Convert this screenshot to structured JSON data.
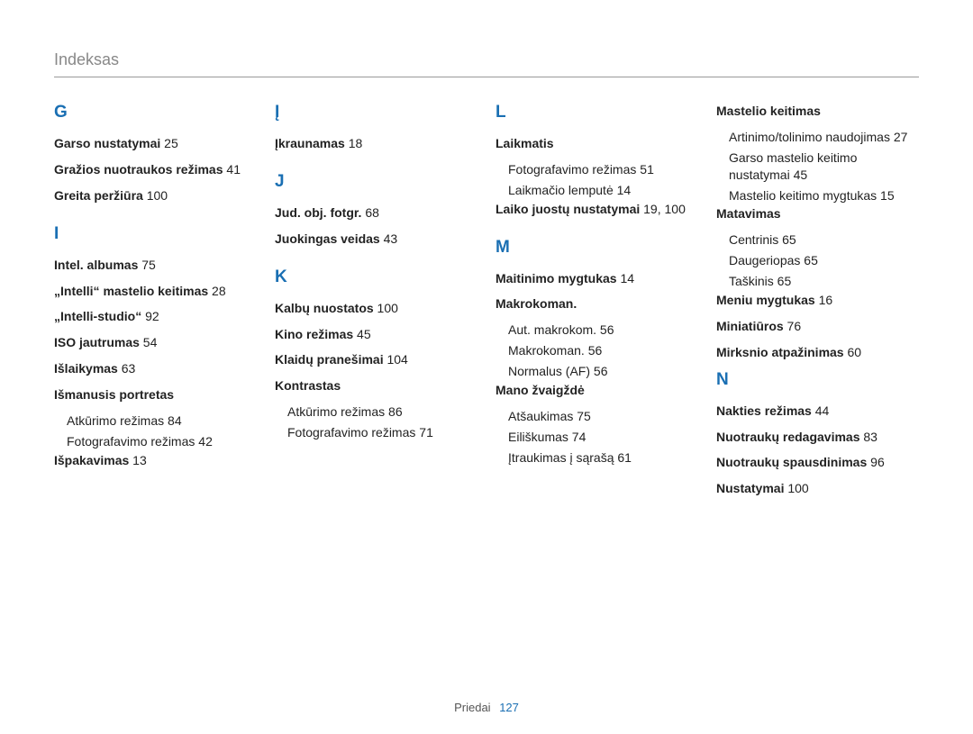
{
  "header": {
    "title": "Indeksas"
  },
  "footer": {
    "section": "Priedai",
    "page": "127"
  },
  "columns": [
    [
      {
        "type": "letter",
        "text": "G"
      },
      {
        "type": "entry",
        "main": "Garso nustatymai",
        "pg": "25"
      },
      {
        "type": "entry",
        "main": "Gražios nuotraukos režimas",
        "pg": "41"
      },
      {
        "type": "entry",
        "main": "Greita peržiūra",
        "pg": "100"
      },
      {
        "type": "letter",
        "text": "I"
      },
      {
        "type": "entry",
        "main": "Intel. albumas",
        "pg": "75"
      },
      {
        "type": "entry",
        "main": "„Intelli“ mastelio keitimas",
        "pg": "28"
      },
      {
        "type": "entry",
        "main": "„Intelli-studio“",
        "pg": "92"
      },
      {
        "type": "entry",
        "main": "ISO jautrumas",
        "pg": "54"
      },
      {
        "type": "entry",
        "main": "Išlaikymas",
        "pg": "63"
      },
      {
        "type": "entry",
        "main": "Išmanusis portretas",
        "subs": [
          {
            "text": "Atkūrimo režimas",
            "pg": "84"
          },
          {
            "text": "Fotografavimo režimas",
            "pg": "42"
          }
        ]
      },
      {
        "type": "entry",
        "main": "Išpakavimas",
        "pg": "13"
      }
    ],
    [
      {
        "type": "letter",
        "text": "Į"
      },
      {
        "type": "entry",
        "main": "Įkraunamas",
        "pg": "18"
      },
      {
        "type": "letter",
        "text": "J"
      },
      {
        "type": "entry",
        "main": "Jud. obj. fotgr.",
        "pg": "68"
      },
      {
        "type": "entry",
        "main": "Juokingas veidas",
        "pg": "43"
      },
      {
        "type": "letter",
        "text": "K"
      },
      {
        "type": "entry",
        "main": "Kalbų nuostatos",
        "pg": "100"
      },
      {
        "type": "entry",
        "main": "Kino režimas",
        "pg": "45"
      },
      {
        "type": "entry",
        "main": "Klaidų pranešimai",
        "pg": "104"
      },
      {
        "type": "entry",
        "main": "Kontrastas",
        "subs": [
          {
            "text": "Atkūrimo režimas",
            "pg": "86"
          },
          {
            "text": "Fotografavimo režimas",
            "pg": "71"
          }
        ]
      }
    ],
    [
      {
        "type": "letter",
        "text": "L"
      },
      {
        "type": "entry",
        "main": "Laikmatis",
        "subs": [
          {
            "text": "Fotografavimo režimas",
            "pg": "51"
          },
          {
            "text": "Laikmačio lemputė",
            "pg": "14"
          }
        ]
      },
      {
        "type": "entry",
        "main": "Laiko juostų nustatymai",
        "pg": "19, 100"
      },
      {
        "type": "letter",
        "text": "M"
      },
      {
        "type": "entry",
        "main": "Maitinimo mygtukas",
        "pg": "14"
      },
      {
        "type": "entry",
        "main": "Makrokoman.",
        "subs": [
          {
            "text": "Aut. makrokom.",
            "pg": "56"
          },
          {
            "text": "Makrokoman.",
            "pg": "56"
          },
          {
            "text": "Normalus (AF)",
            "pg": "56"
          }
        ]
      },
      {
        "type": "entry",
        "main": "Mano žvaigždė",
        "subs": [
          {
            "text": "Atšaukimas",
            "pg": "75"
          },
          {
            "text": "Eiliškumas",
            "pg": "74"
          },
          {
            "text": "Įtraukimas į sąrašą",
            "pg": "61"
          }
        ]
      }
    ],
    [
      {
        "type": "entry",
        "main": "Mastelio keitimas",
        "subs": [
          {
            "text": "Artinimo/tolinimo naudojimas",
            "pg": "27"
          },
          {
            "text": "Garso mastelio keitimo nustatymai",
            "pg": "45"
          },
          {
            "text": "Mastelio keitimo mygtukas",
            "pg": "15"
          }
        ]
      },
      {
        "type": "entry",
        "main": "Matavimas",
        "subs": [
          {
            "text": "Centrinis",
            "pg": "65"
          },
          {
            "text": "Daugeriopas",
            "pg": "65"
          },
          {
            "text": "Taškinis",
            "pg": "65"
          }
        ]
      },
      {
        "type": "entry",
        "main": "Meniu mygtukas",
        "pg": "16"
      },
      {
        "type": "entry",
        "main": "Miniatiūros",
        "pg": "76"
      },
      {
        "type": "entry",
        "main": "Mirksnio atpažinimas",
        "pg": "60"
      },
      {
        "type": "letter",
        "text": "N"
      },
      {
        "type": "entry",
        "main": "Nakties režimas",
        "pg": "44"
      },
      {
        "type": "entry",
        "main": "Nuotraukų redagavimas",
        "pg": "83"
      },
      {
        "type": "entry",
        "main": "Nuotraukų spausdinimas",
        "pg": "96"
      },
      {
        "type": "entry",
        "main": "Nustatymai",
        "pg": "100"
      }
    ]
  ]
}
